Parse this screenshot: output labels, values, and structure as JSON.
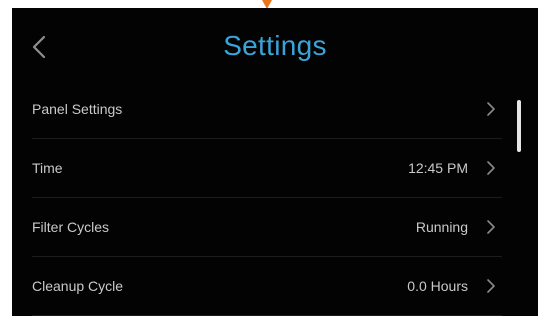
{
  "colors": {
    "background": "#030303",
    "title": "#3aa3d8",
    "text": "#c9c9c9",
    "chevron": "#8a8a8a",
    "accent_marker": "#e8741c"
  },
  "header": {
    "back_icon": "chevron-left-icon",
    "title": "Settings"
  },
  "settings": {
    "items": [
      {
        "label": "Panel Settings",
        "value": "",
        "icon": "chevron-right-icon"
      },
      {
        "label": "Time",
        "value": "12:45 PM",
        "icon": "chevron-right-icon"
      },
      {
        "label": "Filter Cycles",
        "value": "Running",
        "icon": "chevron-right-icon"
      },
      {
        "label": "Cleanup Cycle",
        "value": "0.0 Hours",
        "icon": "chevron-right-icon"
      }
    ]
  },
  "scrollbar": {
    "position_fraction": 0.0
  }
}
